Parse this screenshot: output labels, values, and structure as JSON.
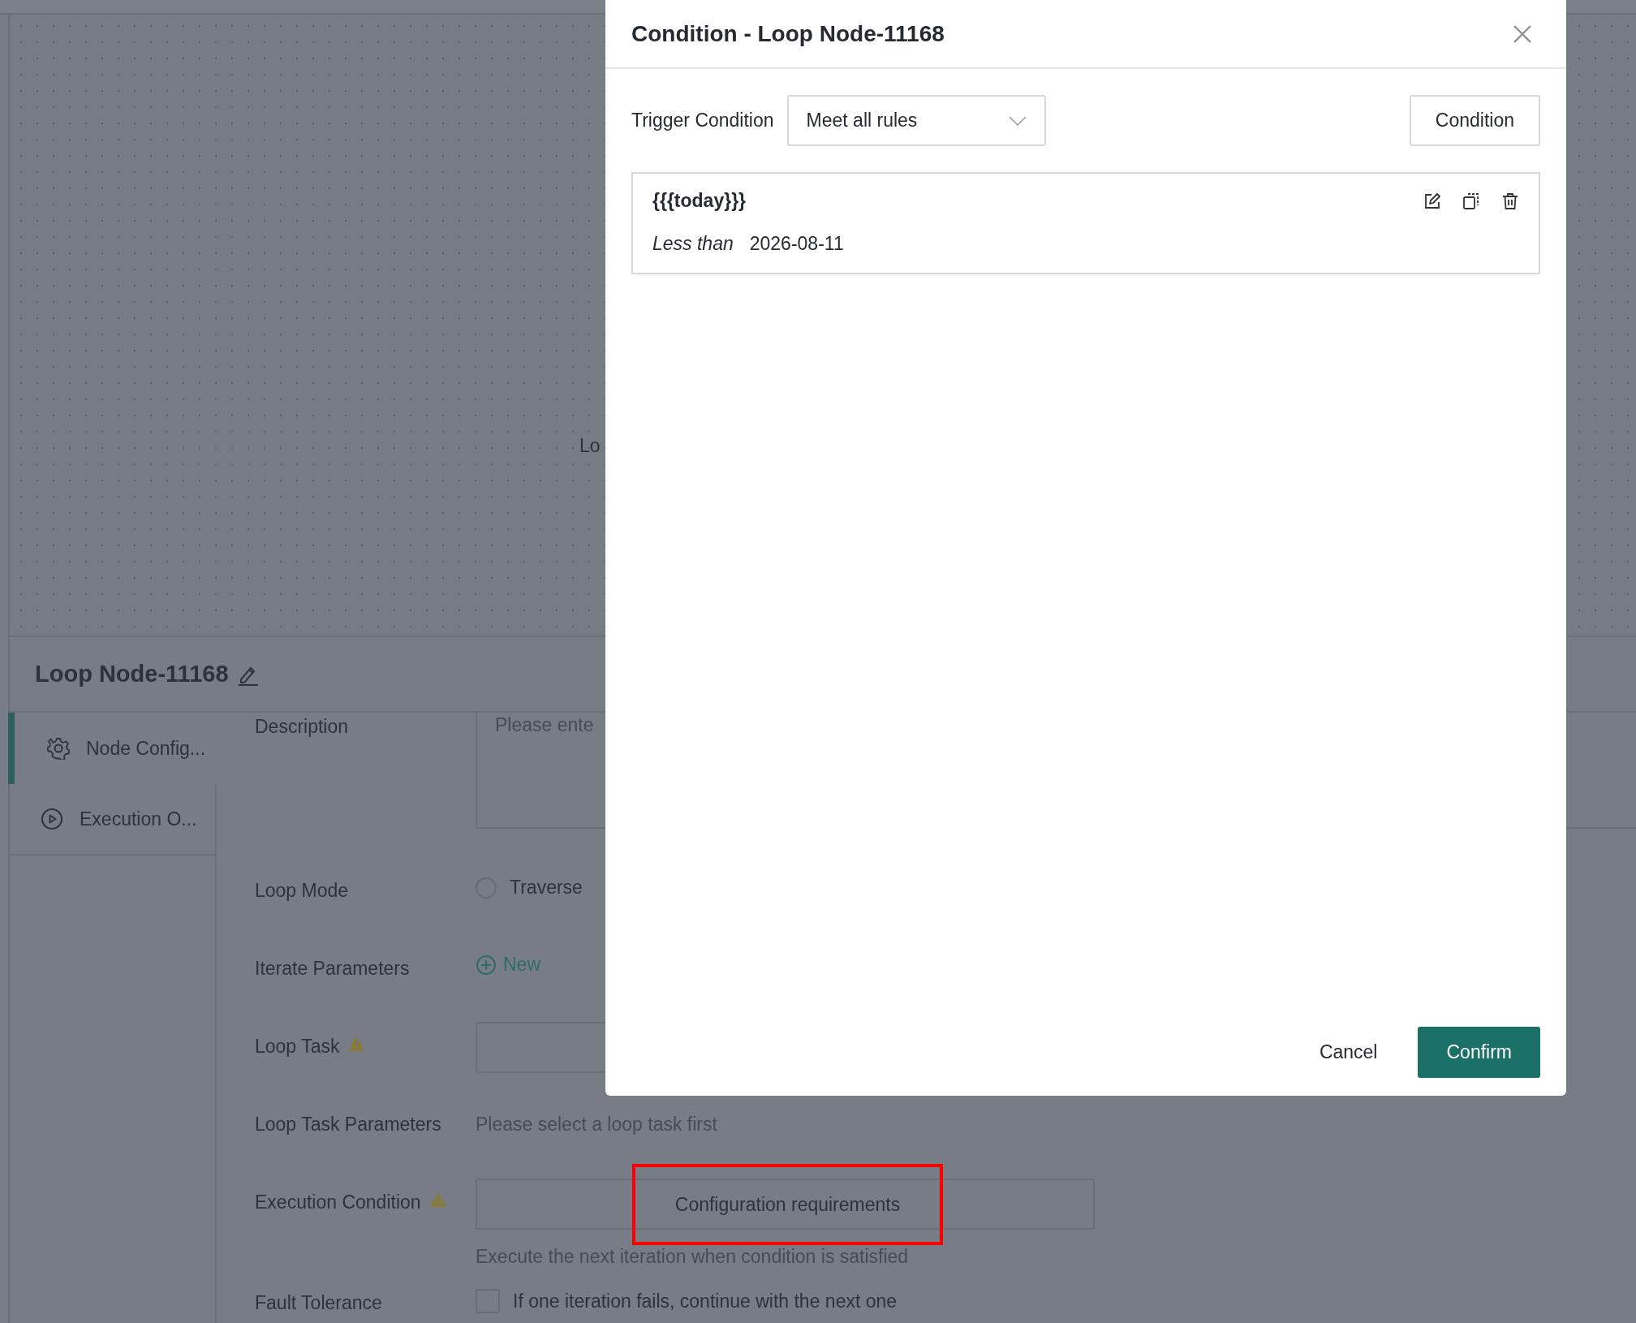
{
  "canvas": {
    "node_label": "Lo"
  },
  "panel": {
    "title": "Loop Node-11168",
    "tabs": [
      {
        "label": "Node Config...",
        "selected": true
      },
      {
        "label": "Execution O...",
        "selected": false
      }
    ],
    "fields": [
      {
        "kind": "textarea",
        "label": "Description",
        "placeholder": "Please ente"
      },
      {
        "kind": "radio",
        "label": "Loop Mode",
        "options": [
          {
            "label": "Traverse",
            "selected": false
          }
        ]
      },
      {
        "kind": "add",
        "label": "Iterate Parameters",
        "action": "New"
      },
      {
        "kind": "select",
        "label": "Loop Task",
        "warning": true
      },
      {
        "kind": "note",
        "label": "Loop Task Parameters",
        "text": "Please select a loop task first"
      },
      {
        "kind": "condition",
        "label": "Execution Condition",
        "warning": true,
        "value": "Configuration requirements",
        "highlighted": true,
        "hint": "Execute the next iteration when condition is satisfied"
      },
      {
        "kind": "checkbox",
        "label": "Fault Tolerance",
        "checked": false,
        "text": "If one iteration fails, continue with the next one"
      }
    ]
  },
  "dialog": {
    "title": "Condition - Loop Node-11168",
    "trigger": {
      "label": "Trigger Condition",
      "value": "Meet all rules"
    },
    "add_button": "Condition",
    "rules": [
      {
        "field": "{{{today}}}",
        "operator": "Less than",
        "value": "2026-08-11"
      }
    ],
    "cancel": "Cancel",
    "confirm": "Confirm"
  }
}
